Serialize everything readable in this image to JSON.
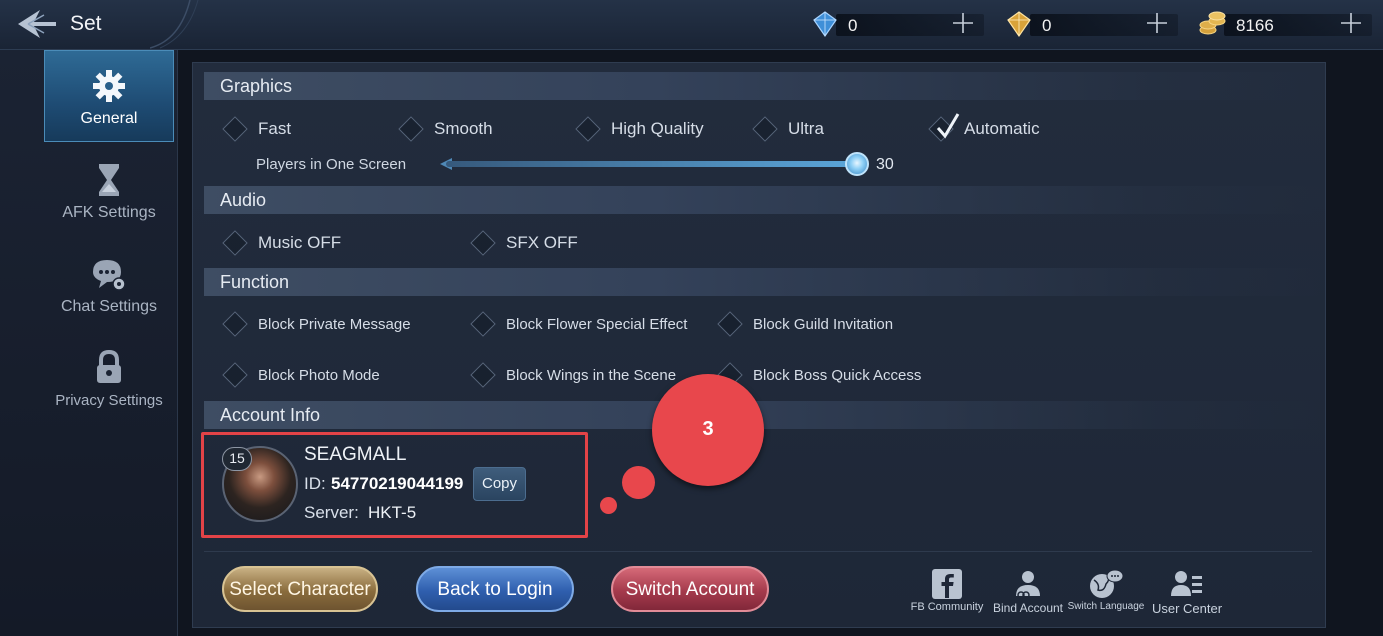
{
  "header": {
    "title": "Set",
    "back_icon": "back-arrow-icon",
    "currencies": [
      {
        "icon": "blue-diamond-icon",
        "value": "0"
      },
      {
        "icon": "gold-diamond-icon",
        "value": "0"
      },
      {
        "icon": "gold-coins-icon",
        "value": "8166"
      }
    ]
  },
  "sidebar": {
    "items": [
      {
        "label": "General",
        "icon": "gear-icon",
        "active": true
      },
      {
        "label": "AFK Settings",
        "icon": "hourglass-icon",
        "active": false
      },
      {
        "label": "Chat Settings",
        "icon": "chat-gear-icon",
        "active": false
      },
      {
        "label": "Privacy Settings",
        "icon": "lock-icon",
        "active": false
      }
    ]
  },
  "graphics": {
    "title": "Graphics",
    "options": [
      "Fast",
      "Smooth",
      "High Quality",
      "Ultra",
      "Automatic"
    ],
    "selected": "Automatic",
    "slider_label": "Players in One Screen",
    "slider_value": "30"
  },
  "audio": {
    "title": "Audio",
    "options": [
      "Music OFF",
      "SFX OFF"
    ]
  },
  "function": {
    "title": "Function",
    "options": [
      "Block Private Message",
      "Block Flower Special Effect",
      "Block Guild Invitation",
      "Block Photo Mode",
      "Block Wings in the Scene",
      "Block Boss Quick Access"
    ]
  },
  "account": {
    "title": "Account Info",
    "level": "15",
    "name": "SEAGMALL",
    "id_label": "ID:",
    "id_value": "54770219044199",
    "copy_label": "Copy",
    "server_label": "Server:",
    "server_value": "HKT-5"
  },
  "buttons": {
    "select_character": "Select Character",
    "back_to_login": "Back to Login",
    "switch_account": "Switch Account"
  },
  "links": [
    {
      "label": "FB Community",
      "icon": "facebook-icon"
    },
    {
      "label": "Bind Account",
      "icon": "bind-account-icon"
    },
    {
      "label": "Switch Language",
      "icon": "globe-icon"
    },
    {
      "label": "User Center",
      "icon": "user-center-icon"
    }
  ],
  "annotation": {
    "number": "3",
    "color": "#e8474c"
  }
}
